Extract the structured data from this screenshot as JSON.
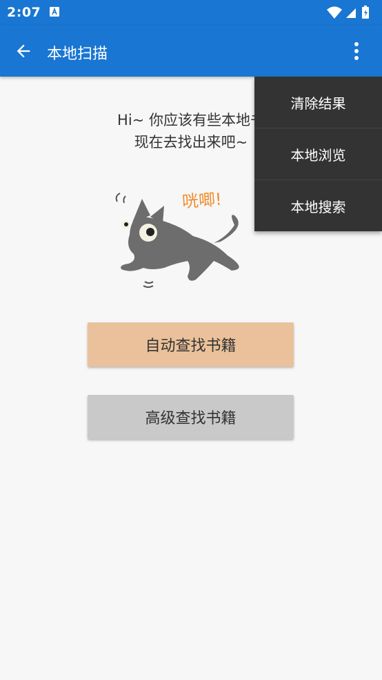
{
  "status": {
    "time": "2:07",
    "a_icon": "a-notification-icon",
    "wifi_icon": "wifi-icon",
    "signal_icon": "signal-icon",
    "battery_icon": "battery-icon"
  },
  "appbar": {
    "title": "本地扫描",
    "back_icon": "arrow-back-icon",
    "menu_icon": "overflow-menu-icon"
  },
  "main": {
    "hint_line1": "Hi~ 你应该有些本地书",
    "hint_line2": "现在去找出来吧~",
    "cat_caption": "咣唧!",
    "auto_button": "自动查找书籍",
    "advanced_button": "高级查找书籍"
  },
  "menu": {
    "items": [
      {
        "label": "清除结果"
      },
      {
        "label": "本地浏览"
      },
      {
        "label": "本地搜索"
      }
    ]
  },
  "colors": {
    "primary": "#1976d2",
    "auto_button": "#eac19a",
    "advanced_button": "#c9c9c9",
    "menu_bg": "#333333",
    "caption": "#f08c2a"
  }
}
